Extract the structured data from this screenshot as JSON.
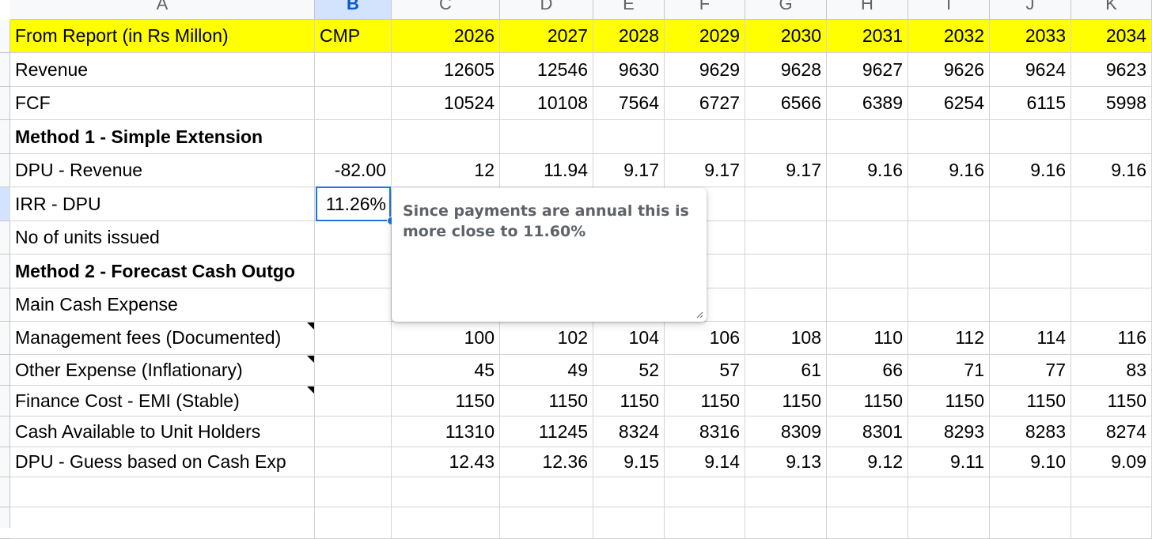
{
  "column_headers": [
    "A",
    "B",
    "C",
    "D",
    "E",
    "F",
    "G",
    "H",
    "I",
    "J",
    "K"
  ],
  "selected_column": "B",
  "rows": [
    {
      "label": "From Report (in Rs Millon)",
      "cmp": "CMP",
      "values": [
        "2026",
        "2027",
        "2028",
        "2029",
        "2030",
        "2031",
        "2032",
        "2033",
        "2034"
      ],
      "style": "header"
    },
    {
      "label": "Revenue",
      "cmp": "",
      "values": [
        "12605",
        "12546",
        "9630",
        "9629",
        "9628",
        "9627",
        "9626",
        "9624",
        "9623"
      ],
      "style": "normal"
    },
    {
      "label": "FCF",
      "cmp": "",
      "values": [
        "10524",
        "10108",
        "7564",
        "6727",
        "6566",
        "6389",
        "6254",
        "6115",
        "5998"
      ],
      "style": "normal"
    },
    {
      "label": "Method 1 - Simple Extension",
      "cmp": "",
      "values": [
        "",
        "",
        "",
        "",
        "",
        "",
        "",
        "",
        ""
      ],
      "style": "bold"
    },
    {
      "label": "DPU - Revenue",
      "cmp": "-82.00",
      "values": [
        "12",
        "11.94",
        "9.17",
        "9.17",
        "9.17",
        "9.16",
        "9.16",
        "9.16",
        "9.16"
      ],
      "style": "normal"
    },
    {
      "label": "IRR - DPU",
      "cmp": "11.26%",
      "values": [
        "",
        "",
        "",
        "",
        "",
        "",
        "",
        "",
        ""
      ],
      "style": "normal"
    },
    {
      "label": "No of units issued",
      "cmp": "",
      "values": [
        "",
        "",
        "",
        "",
        "",
        "",
        "",
        "",
        ""
      ],
      "style": "normal"
    },
    {
      "label": "Method 2 - Forecast Cash Outgo",
      "cmp": "",
      "values": [
        "",
        "",
        "",
        "",
        "",
        "",
        "",
        "",
        ""
      ],
      "style": "bold"
    },
    {
      "label": "Main Cash Expense",
      "cmp": "",
      "values": [
        "",
        "",
        "",
        "",
        "",
        "",
        "",
        "",
        ""
      ],
      "style": "normal"
    },
    {
      "label": "Management fees (Documented)",
      "cmp": "",
      "values": [
        "100",
        "102",
        "104",
        "106",
        "108",
        "110",
        "112",
        "114",
        "116"
      ],
      "style": "arial",
      "note": true
    },
    {
      "label": "Other Expense (Inflationary)",
      "cmp": "",
      "values": [
        "45",
        "49",
        "52",
        "57",
        "61",
        "66",
        "71",
        "77",
        "83"
      ],
      "style": "arial",
      "note": true
    },
    {
      "label": "Finance Cost - EMI (Stable)",
      "cmp": "",
      "values": [
        "1150",
        "1150",
        "1150",
        "1150",
        "1150",
        "1150",
        "1150",
        "1150",
        "1150"
      ],
      "style": "arial",
      "note": true
    },
    {
      "label": "Cash Available to Unit Holders",
      "cmp": "",
      "values": [
        "11310",
        "11245",
        "8324",
        "8316",
        "8309",
        "8301",
        "8293",
        "8283",
        "8274"
      ],
      "style": "arial"
    },
    {
      "label": "DPU - Guess based on Cash Exp",
      "cmp": "",
      "values": [
        "12.43",
        "12.36",
        "9.15",
        "9.14",
        "9.13",
        "9.12",
        "9.11",
        "9.10",
        "9.09"
      ],
      "style": "arial"
    },
    {
      "label": "",
      "cmp": "",
      "values": [
        "",
        "",
        "",
        "",
        "",
        "",
        "",
        "",
        ""
      ],
      "style": "normal"
    },
    {
      "label": "",
      "cmp": "",
      "values": [
        "",
        "",
        "",
        "",
        "",
        "",
        "",
        "",
        ""
      ],
      "style": "normal"
    }
  ],
  "comment": {
    "text": "Since payments are annual this is\nmore close to 11.60%",
    "anchored_to": "B6"
  },
  "colors": {
    "header_row_fill": "#ffff00",
    "selection": "#1a73e8",
    "selected_header": "#d3e3fd"
  },
  "icons": {
    "comment_resize": "resize-handle-icon",
    "note_indicator": "note-triangle-icon"
  }
}
